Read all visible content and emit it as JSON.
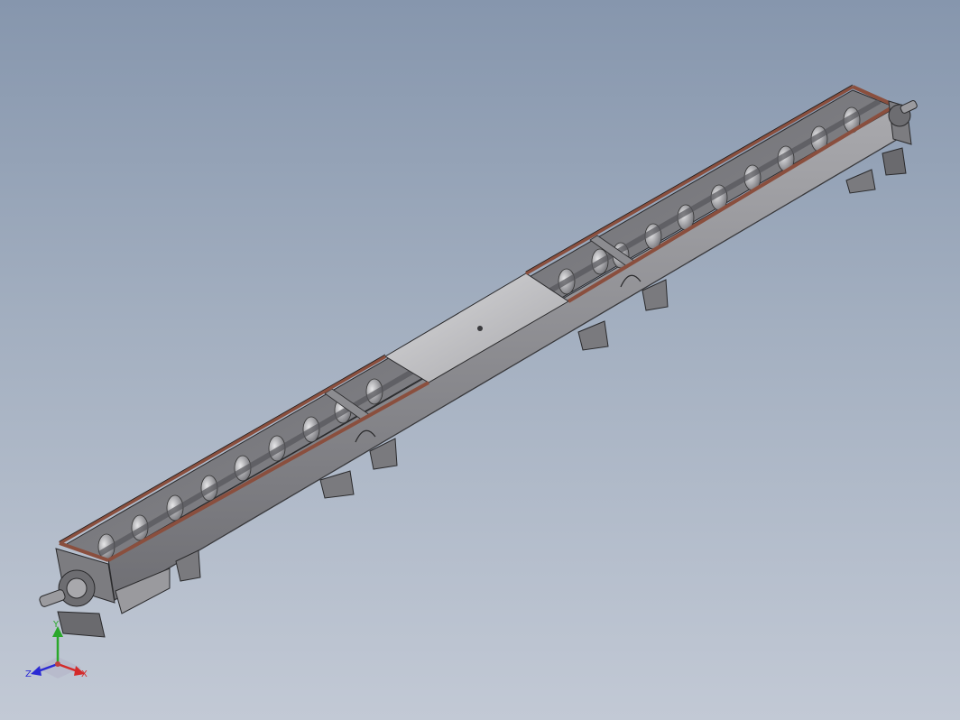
{
  "viewport": {
    "background_top": "#8696ad",
    "background_bottom": "#c2c9d5"
  },
  "model": {
    "name": "screw-conveyor",
    "colors": {
      "steel": "#8e8e92",
      "steel_light": "#c9c9cc",
      "steel_dark": "#4c4c50",
      "flange": "#8a4f3e",
      "edge": "#222222"
    }
  },
  "triad": {
    "y_label": "Y",
    "x_label": "X",
    "z_label": "Z",
    "colors": {
      "x": "#d42a2a",
      "y": "#2aa82a",
      "z": "#2a2ad4"
    }
  }
}
